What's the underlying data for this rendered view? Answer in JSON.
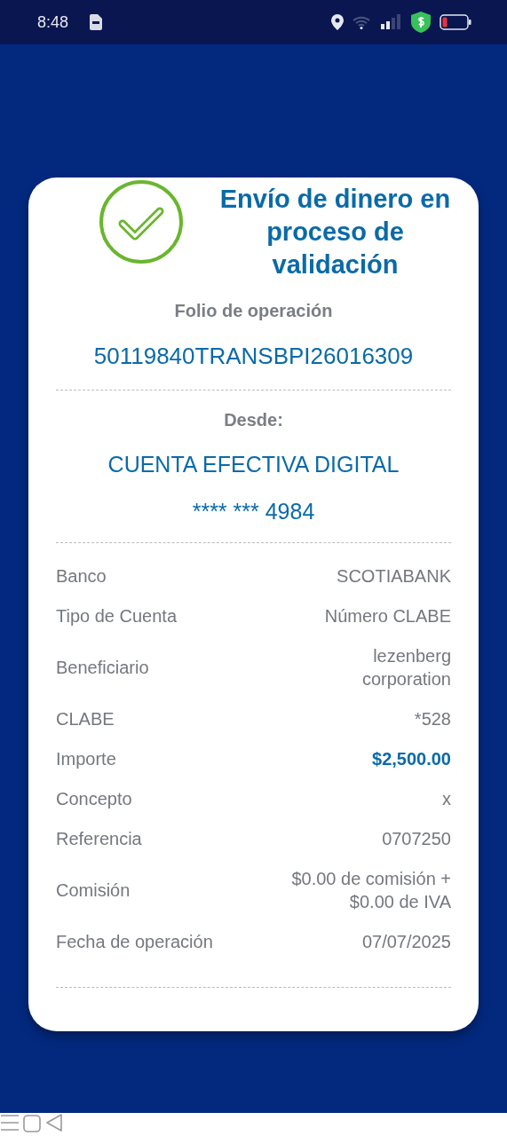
{
  "status_bar": {
    "time": "8:48"
  },
  "header": {
    "title": "Envío de dinero en proceso de validación"
  },
  "folio": {
    "label": "Folio de operación",
    "value": "50119840TRANSBPI26016309"
  },
  "source": {
    "label": "Desde:",
    "account_name": "CUENTA EFECTIVA DIGITAL",
    "account_number": "**** *** 4984"
  },
  "details": [
    {
      "kind": "plain",
      "label": "Banco",
      "lines": [
        "SCOTIABANK"
      ]
    },
    {
      "kind": "plain",
      "label": "Tipo de Cuenta",
      "lines": [
        "Número CLABE"
      ]
    },
    {
      "kind": "plain",
      "label": "Beneficiario",
      "lines": [
        "lezenberg",
        "corporation"
      ]
    },
    {
      "kind": "plain",
      "label": "CLABE",
      "lines": [
        "*528"
      ]
    },
    {
      "kind": "amount",
      "label": "Importe",
      "lines": [
        "$2,500.00"
      ]
    },
    {
      "kind": "plain",
      "label": "Concepto",
      "lines": [
        "x"
      ]
    },
    {
      "kind": "plain",
      "label": "Referencia",
      "lines": [
        "0707250"
      ]
    },
    {
      "kind": "plain",
      "label": "Comisión",
      "lines": [
        "$0.00 de comisión +",
        "$0.00 de IVA"
      ]
    },
    {
      "kind": "plain",
      "label": "Fecha de operación",
      "lines": [
        "07/07/2025"
      ]
    }
  ]
}
